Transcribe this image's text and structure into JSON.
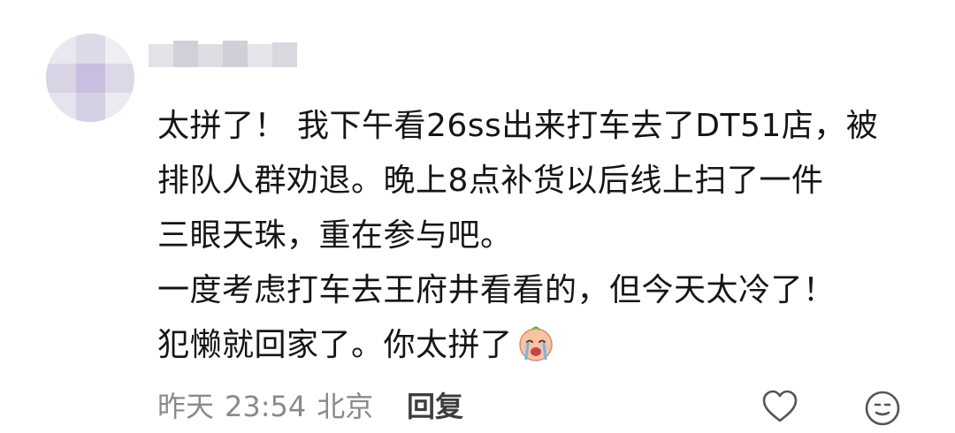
{
  "comment": {
    "lines": [
      "太拼了！ 我下午看26ss出来打车去了DT51店，被",
      "排队人群劝退。晚上8点补货以后线上扫了一件",
      "三眼天珠，重在参与吧。",
      "一度考虑打车去王府井看看的，但今天太冷了！",
      "犯懒就回家了。你太拼了"
    ],
    "emoji_icon": "crying-face-emoji",
    "meta": {
      "date": "昨天",
      "time": "23:54",
      "location": "北京",
      "reply_label": "回复"
    },
    "actions": {
      "like_icon": "heart-outline-icon",
      "react_icon": "smiley-face-icon"
    }
  },
  "colors": {
    "text": "#151515",
    "meta_text": "#8a8a8a",
    "reply_text": "#3d3d3d",
    "icon_stroke": "#555555"
  }
}
